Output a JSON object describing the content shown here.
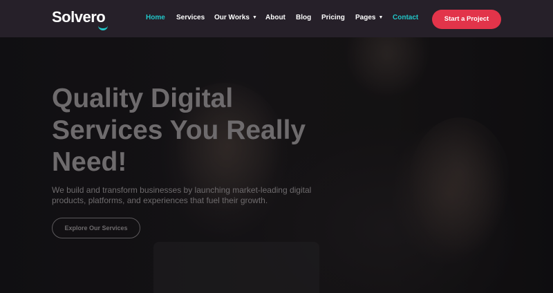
{
  "brand": {
    "name": "Solvero",
    "accent": "#21c7c9"
  },
  "nav": {
    "items": [
      {
        "label": "Home",
        "active": true
      },
      {
        "label": "Services"
      },
      {
        "label": "Our Works",
        "dropdown": true
      },
      {
        "label": "About"
      },
      {
        "label": "Blog"
      },
      {
        "label": "Pricing"
      },
      {
        "label": "Pages",
        "dropdown": true
      },
      {
        "label": "Contact",
        "highlight": true
      }
    ],
    "cta_label": "Start a Project",
    "cta_color": "#e2344a",
    "caret_icon": "chevron-down-icon"
  },
  "hero": {
    "headline": "Quality Digital Services You Really Need!",
    "subtext": "We build and transform businesses by launching market-leading digital products, platforms, and experiences that fuel their growth.",
    "button_label": "Explore Our Services"
  }
}
